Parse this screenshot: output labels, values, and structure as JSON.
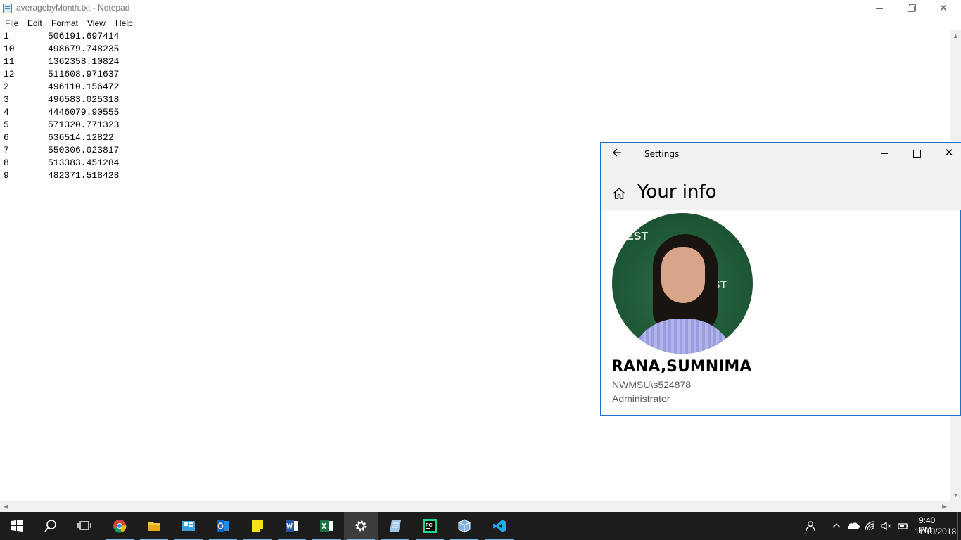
{
  "notepad": {
    "title": "averagebyMonth.txt - Notepad",
    "menu": [
      "File",
      "Edit",
      "Format",
      "View",
      "Help"
    ],
    "lines": [
      {
        "key": "1",
        "value": "506191.697414"
      },
      {
        "key": "10",
        "value": "498679.748235"
      },
      {
        "key": "11",
        "value": "1362358.10824"
      },
      {
        "key": "12",
        "value": "511608.971637"
      },
      {
        "key": "2",
        "value": "496110.156472"
      },
      {
        "key": "3",
        "value": "496583.025318"
      },
      {
        "key": "4",
        "value": "4446079.90555"
      },
      {
        "key": "5",
        "value": "571320.771323"
      },
      {
        "key": "6",
        "value": "636514.12822"
      },
      {
        "key": "7",
        "value": "550306.023817"
      },
      {
        "key": "8",
        "value": "513383.451284"
      },
      {
        "key": "9",
        "value": "482371.518428"
      }
    ]
  },
  "settings": {
    "title": "Settings",
    "heading": "Your info",
    "user": {
      "name": "RANA,SUMNIMA",
      "account": "NWMSU\\s524878",
      "role": "Administrator"
    },
    "avatar_text": [
      "EST",
      "EST"
    ]
  },
  "taskbar": {
    "apps": [
      {
        "name": "start-icon",
        "color": "#ffffff"
      },
      {
        "name": "search-icon",
        "color": "#ffffff"
      },
      {
        "name": "task-view-icon",
        "color": "#ffffff"
      },
      {
        "name": "chrome-icon",
        "color": "#4285f4"
      },
      {
        "name": "file-explorer-icon",
        "color": "#f8c94a"
      },
      {
        "name": "control-panel-icon",
        "color": "#3aa0e0"
      },
      {
        "name": "outlook-icon",
        "color": "#0a64c8"
      },
      {
        "name": "sticky-notes-icon",
        "color": "#f5e21b"
      },
      {
        "name": "word-icon",
        "color": "#2b5797"
      },
      {
        "name": "excel-icon",
        "color": "#1e7145"
      },
      {
        "name": "settings-icon",
        "color": "#ffffff"
      },
      {
        "name": "notepad-icon",
        "color": "#9fc6e8"
      },
      {
        "name": "pycharm-icon",
        "color": "#21d789"
      },
      {
        "name": "virtualbox-icon",
        "color": "#7fb4e6"
      },
      {
        "name": "vscode-icon",
        "color": "#23a9f2"
      }
    ],
    "clock": {
      "time": "9:40 PM",
      "date": "11/19/2018"
    }
  }
}
